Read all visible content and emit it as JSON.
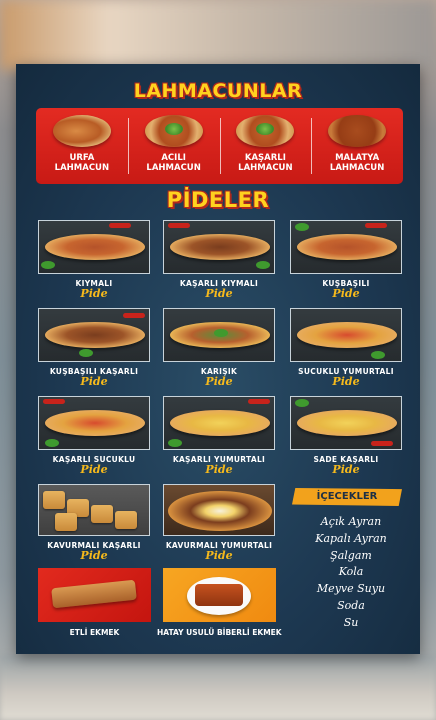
{
  "lahmacun_section": {
    "title": "LAHMACUNLAR",
    "items": [
      {
        "line1": "URFA",
        "line2": "LAHMACUN"
      },
      {
        "line1": "ACILI",
        "line2": "LAHMACUN"
      },
      {
        "line1": "KAŞARLI",
        "line2": "LAHMACUN"
      },
      {
        "line1": "MALATYA",
        "line2": "LAHMACUN"
      }
    ]
  },
  "pide_section": {
    "title": "PİDELER",
    "items": [
      {
        "name": "KIYMALI",
        "sub": "Pide"
      },
      {
        "name": "KAŞARLI KIYMALI",
        "sub": "Pide"
      },
      {
        "name": "KUŞBAŞILI",
        "sub": "Pide"
      },
      {
        "name": "KUŞBAŞILI KAŞARLI",
        "sub": "Pide"
      },
      {
        "name": "KARIŞIK",
        "sub": "Pide"
      },
      {
        "name": "SUCUKLU YUMURTALI",
        "sub": "Pide"
      },
      {
        "name": "KAŞARLI SUCUKLU",
        "sub": "Pide"
      },
      {
        "name": "KAŞARLI YUMURTALI",
        "sub": "Pide"
      },
      {
        "name": "SADE KAŞARLI",
        "sub": "Pide"
      },
      {
        "name": "KAVURMALI KAŞARLI",
        "sub": "Pide"
      },
      {
        "name": "KAVURMALI YUMURTALI",
        "sub": "Pide"
      }
    ]
  },
  "bottom_items": [
    {
      "name": "ETLİ EKMEK"
    },
    {
      "name": "HATAY USULÜ BİBERLİ EKMEK"
    }
  ],
  "drinks": {
    "title": "İÇECEKLER",
    "items": [
      "Açık Ayran",
      "Kapalı Ayran",
      "Şalgam",
      "Kola",
      "Meyve Suyu",
      "Soda",
      "Su"
    ]
  },
  "colors": {
    "poster_bg": "#1d3851",
    "title_yellow": "#ffd21f",
    "title_outline": "#b1281c",
    "lahmacun_bar_red": "#d8231b",
    "pide_label": "#f5b91c",
    "drinks_badge": "#f2a21c"
  }
}
